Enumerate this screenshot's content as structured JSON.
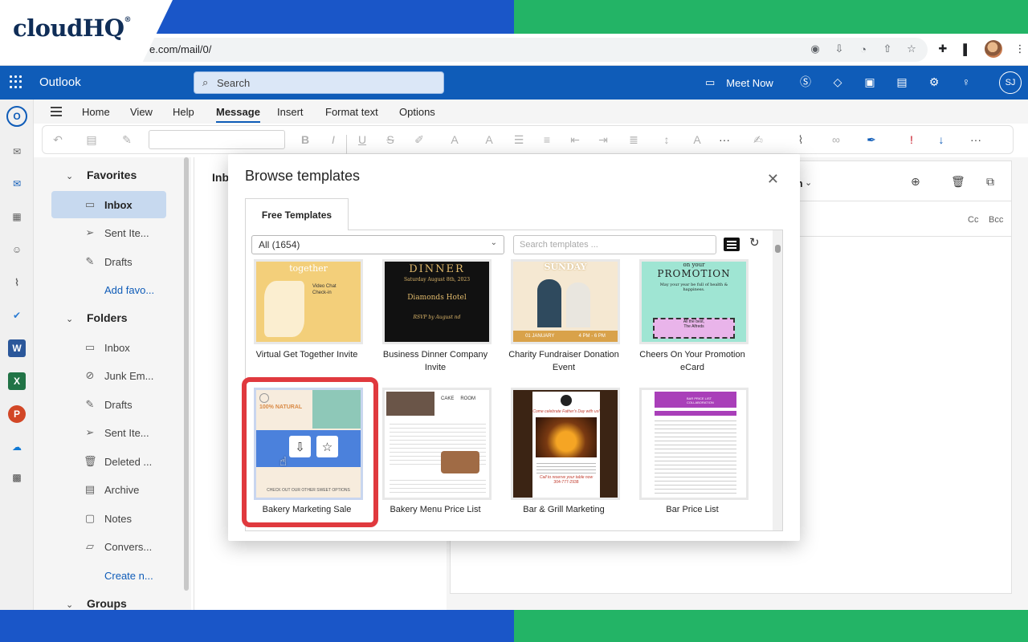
{
  "branding": {
    "logo_text": "cloudHQ",
    "logo_reg": "®"
  },
  "browser": {
    "url": "e.com/mail/0/"
  },
  "outlook": {
    "app_name": "Outlook",
    "search_placeholder": "Search",
    "meet_now": "Meet Now",
    "avatar_initials": "SJ"
  },
  "ribbon": {
    "tabs": [
      "Home",
      "View",
      "Help",
      "Message",
      "Insert",
      "Format text",
      "Options"
    ],
    "active_tab": "Message"
  },
  "folders": {
    "favorites_label": "Favorites",
    "favorites": [
      {
        "label": "Inbox",
        "icon": "inbox-icon",
        "selected": true
      },
      {
        "label": "Sent Ite...",
        "icon": "send-icon"
      },
      {
        "label": "Drafts",
        "icon": "pencil-icon"
      }
    ],
    "add_favorite": "Add favo...",
    "folders_label": "Folders",
    "folder_items": [
      {
        "label": "Inbox",
        "icon": "inbox-icon"
      },
      {
        "label": "Junk Em...",
        "icon": "junk-icon"
      },
      {
        "label": "Drafts",
        "icon": "pencil-icon"
      },
      {
        "label": "Sent Ite...",
        "icon": "send-icon"
      },
      {
        "label": "Deleted ...",
        "icon": "trash-icon"
      },
      {
        "label": "Archive",
        "icon": "archive-icon"
      },
      {
        "label": "Notes",
        "icon": "note-icon"
      },
      {
        "label": "Convers...",
        "icon": "folder-icon"
      }
    ],
    "create_new": "Create n...",
    "groups_label": "Groups"
  },
  "message_list": {
    "title_partial": "Inb"
  },
  "compose": {
    "from_partial": "m",
    "cc": "Cc",
    "bcc": "Bcc"
  },
  "modal": {
    "title": "Browse templates",
    "close_glyph": "✕",
    "tab_label": "Free Templates",
    "category_value": "All (1654)",
    "search_placeholder": "Search templates ...",
    "templates": [
      {
        "caption": "Virtual Get Together Invite",
        "art_lines": [
          "together",
          "Video Chat",
          "Check-in"
        ]
      },
      {
        "caption": "Business Dinner Company Invite",
        "art_lines": [
          "DINNER",
          "Saturday August 8th, 2023",
          "Diamonds Hotel",
          "RSVP by August nd"
        ]
      },
      {
        "caption": "Charity Fundraiser Donation Event",
        "art_lines": [
          "SUNDAY",
          "01 JANUARY",
          "4 PM - 6 PM"
        ]
      },
      {
        "caption": "Cheers On Your Promotion eCard",
        "art_lines": [
          "on your",
          "PROMOTION",
          "May your year be full of health & happiness.",
          "All the best,",
          "The Alfreds"
        ]
      },
      {
        "caption": "Bakery Marketing Sale",
        "art_lines": [
          "100% NATURAL",
          "CHECK OUT OUR OTHER SWEET OPTIONS"
        ]
      },
      {
        "caption": "Bakery Menu Price List",
        "art_lines": [
          "CAKE",
          "ROOM"
        ]
      },
      {
        "caption": "Bar & Grill Marketing",
        "art_lines": [
          "Come celebrate Father's Day with us!",
          "Call to reserve your table now",
          "304-777-2938"
        ]
      },
      {
        "caption": "Bar Price List",
        "art_lines": [
          "BAR PRICE LIST COLLABORATION"
        ]
      }
    ]
  },
  "colors": {
    "outlook_blue": "#0f5cb8",
    "highlight_red": "#e0393e",
    "frame_blue": "#1a56c8",
    "frame_green": "#23b466"
  }
}
